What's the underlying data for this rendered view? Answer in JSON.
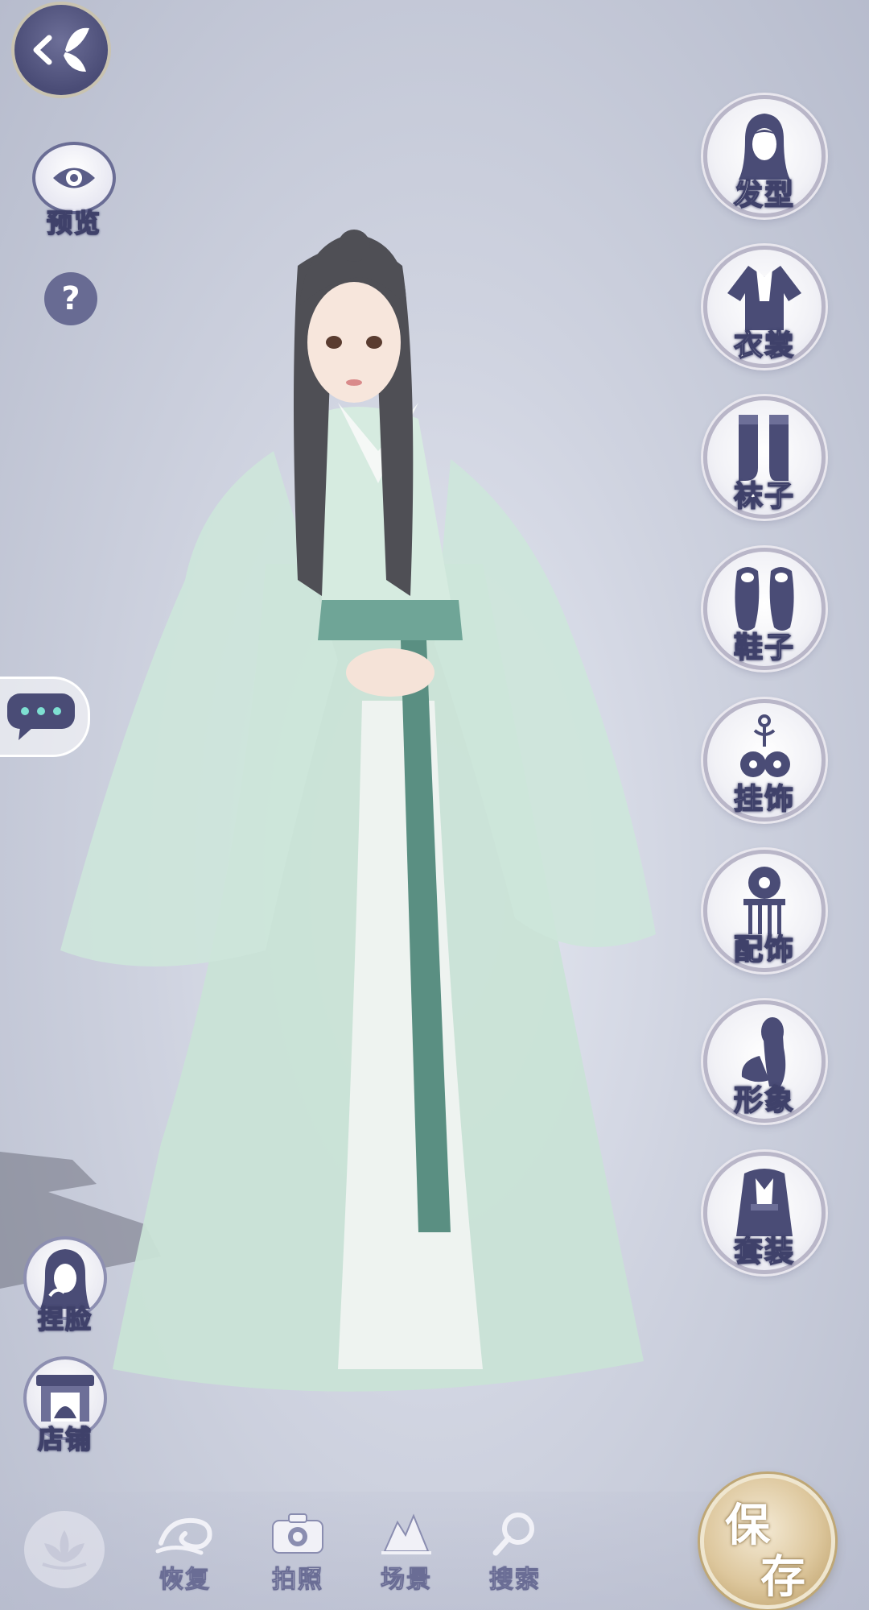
{
  "nav": {
    "back_icon": "back-butterfly-icon"
  },
  "left": {
    "preview_label": "预览",
    "help_label": "?",
    "chat_icon": "chat-bubble-icon"
  },
  "categories": [
    {
      "label": "发型",
      "icon": "hairstyle-icon"
    },
    {
      "label": "衣裳",
      "icon": "clothing-icon"
    },
    {
      "label": "袜子",
      "icon": "socks-icon"
    },
    {
      "label": "鞋子",
      "icon": "shoes-icon"
    },
    {
      "label": "挂饰",
      "icon": "pendant-icon"
    },
    {
      "label": "配饰",
      "icon": "hairpin-accessory-icon"
    },
    {
      "label": "形象",
      "icon": "appearance-icon"
    },
    {
      "label": "套装",
      "icon": "outfit-set-icon"
    }
  ],
  "side_buttons": {
    "face_label": "捏脸",
    "shop_label": "店铺"
  },
  "toolbar": {
    "restore_label": "恢复",
    "photo_label": "拍照",
    "scene_label": "场景",
    "search_label": "搜索"
  },
  "save": {
    "char1": "保",
    "char2": "存"
  },
  "colors": {
    "accent": "#4a4c76",
    "gold": "#ddc79d",
    "robe": "#bcd9cc"
  }
}
